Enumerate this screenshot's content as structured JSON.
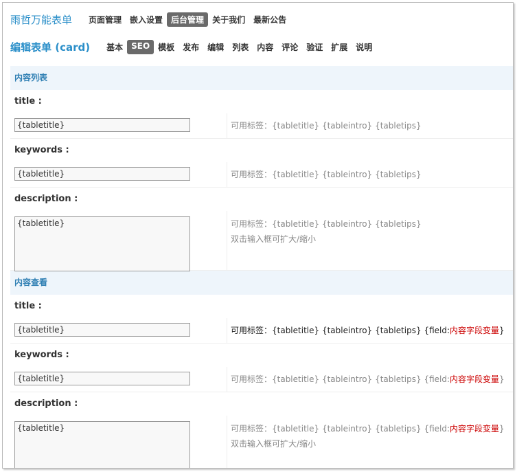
{
  "header": {
    "app_title": "雨哲万能表单",
    "nav": [
      {
        "label": "页面管理",
        "active": false
      },
      {
        "label": "嵌入设置",
        "active": false
      },
      {
        "label": "后台管理",
        "active": true
      },
      {
        "label": "关于我们",
        "active": false
      },
      {
        "label": "最新公告",
        "active": false
      }
    ]
  },
  "editor": {
    "title": "编辑表单 (card)",
    "tabs": [
      {
        "label": "基本",
        "active": false
      },
      {
        "label": "SEO",
        "active": true
      },
      {
        "label": "模板",
        "active": false
      },
      {
        "label": "发布",
        "active": false
      },
      {
        "label": "编辑",
        "active": false
      },
      {
        "label": "列表",
        "active": false
      },
      {
        "label": "内容",
        "active": false
      },
      {
        "label": "评论",
        "active": false
      },
      {
        "label": "验证",
        "active": false
      },
      {
        "label": "扩展",
        "active": false
      },
      {
        "label": "说明",
        "active": false
      }
    ]
  },
  "list_section": {
    "title": "内容列表",
    "title_label": "title :",
    "title_value": "{tabletitle}",
    "title_hint": "可用标签：{tabletitle} {tableintro} {tabletips}",
    "keywords_label": "keywords :",
    "keywords_value": "{tabletitle}",
    "keywords_hint": "可用标签：{tabletitle} {tableintro} {tabletips}",
    "description_label": "description :",
    "description_value": "{tabletitle}",
    "description_hint": "可用标签：{tabletitle} {tableintro} {tabletips}",
    "description_hint2": "双击输入框可扩大/缩小"
  },
  "view_section": {
    "title": "内容查看",
    "title_label": "title :",
    "title_value": "{tabletitle}",
    "title_hint_prefix": "可用标签：{tabletitle} {tableintro} {tabletips} {field:",
    "title_hint_var": "内容字段变量",
    "title_hint_suffix": "}",
    "keywords_label": "keywords :",
    "keywords_value": "{tabletitle}",
    "keywords_hint_prefix": "可用标签：{tabletitle} {tableintro} {tabletips} {field:",
    "keywords_hint_var": "内容字段变量",
    "keywords_hint_suffix": "}",
    "description_label": "description :",
    "description_value": "{tabletitle}",
    "description_hint_prefix": "可用标签：{tabletitle} {tableintro} {tabletips} {field:",
    "description_hint_var": "内容字段变量",
    "description_hint_suffix": "}",
    "description_hint2": "双击输入框可扩大/缩小"
  },
  "colors": {
    "accent": "#2b8fc9",
    "section_bg": "#eef5fb",
    "active_tab_bg": "#6a6a6a",
    "variable_red": "#cc0000"
  }
}
